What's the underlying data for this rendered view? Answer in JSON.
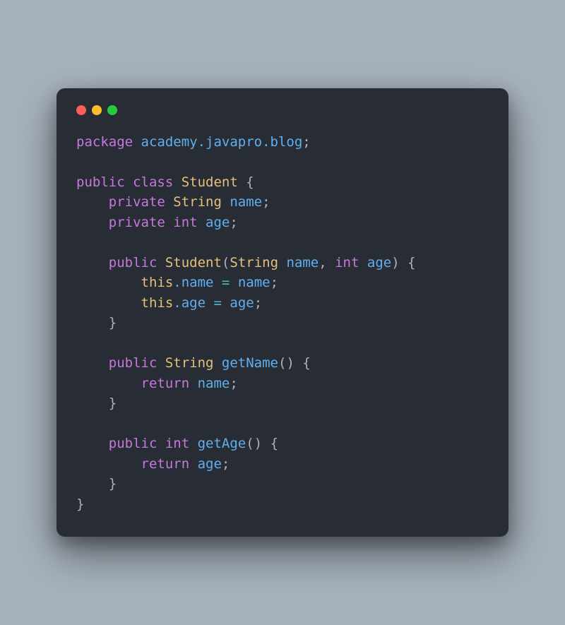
{
  "traffic_lights": {
    "red": "#ff5f56",
    "yellow": "#ffbd2e",
    "green": "#27c93f"
  },
  "code": {
    "line1": {
      "kw_package": "package",
      "pkg": " academy.javapro.blog",
      "semi": ";"
    },
    "line2": "",
    "line3": {
      "kw_public": "public",
      "kw_class": " class",
      "cls_name": " Student",
      "brace": " {"
    },
    "line4": {
      "indent": "    ",
      "kw_private": "private",
      "type": " String",
      "var": " name",
      "semi": ";"
    },
    "line5": {
      "indent": "    ",
      "kw_private": "private",
      "type": " int",
      "var": " age",
      "semi": ";"
    },
    "line6": "",
    "line7": {
      "indent": "    ",
      "kw_public": "public",
      "ctor": " Student",
      "paren_open": "(",
      "p1_type": "String",
      "p1_name": " name",
      "comma": ",",
      "p2_type": " int",
      "p2_name": " age",
      "paren_close": ")",
      "brace": " {"
    },
    "line8": {
      "indent": "        ",
      "this": "this",
      "dot_name": ".name",
      "eq": " = ",
      "val": "name",
      "semi": ";"
    },
    "line9": {
      "indent": "        ",
      "this": "this",
      "dot_age": ".age",
      "eq": " = ",
      "val": "age",
      "semi": ";"
    },
    "line10": {
      "indent": "    ",
      "brace": "}"
    },
    "line11": "",
    "line12": {
      "indent": "    ",
      "kw_public": "public",
      "type": " String",
      "method": " getName",
      "parens": "()",
      "brace": " {"
    },
    "line13": {
      "indent": "        ",
      "kw_return": "return",
      "val": " name",
      "semi": ";"
    },
    "line14": {
      "indent": "    ",
      "brace": "}"
    },
    "line15": "",
    "line16": {
      "indent": "    ",
      "kw_public": "public",
      "type": " int",
      "method": " getAge",
      "parens": "()",
      "brace": " {"
    },
    "line17": {
      "indent": "        ",
      "kw_return": "return",
      "val": " age",
      "semi": ";"
    },
    "line18": {
      "indent": "    ",
      "brace": "}"
    },
    "line19": {
      "brace": "}"
    }
  }
}
